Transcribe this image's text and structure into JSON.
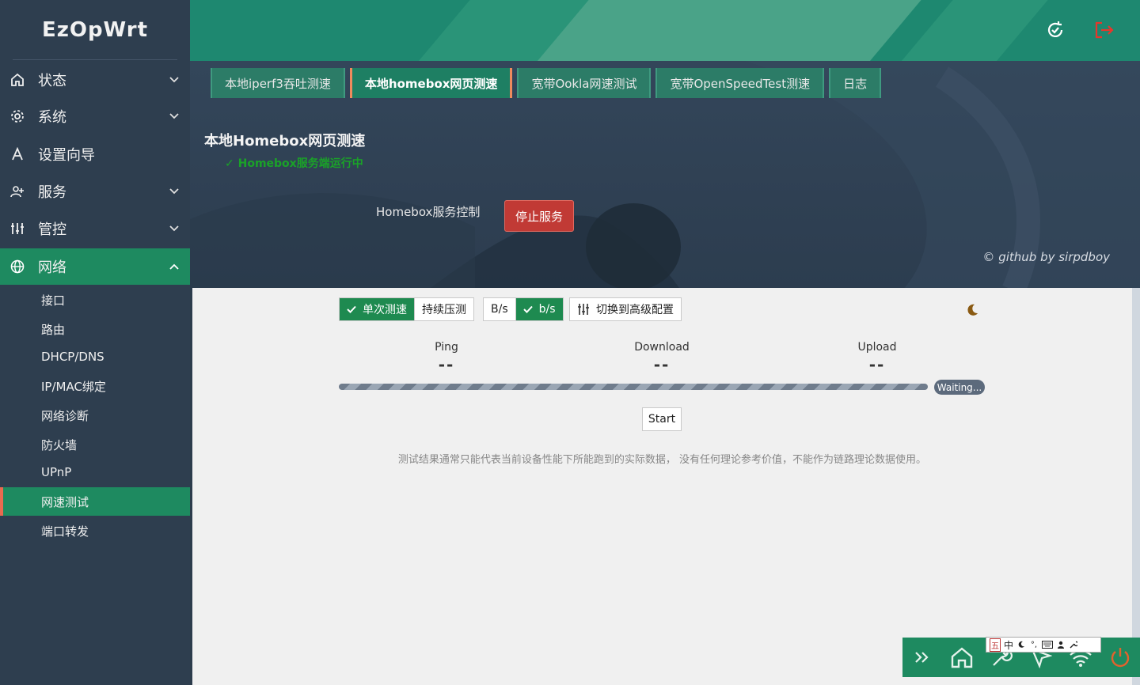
{
  "brand": "EzOpWrt",
  "menu": [
    {
      "label": "状态",
      "icon": "home-icon",
      "has_arrow": true
    },
    {
      "label": "系统",
      "icon": "gear-icon",
      "has_arrow": true
    },
    {
      "label": "设置向导",
      "icon": "wizard-icon",
      "has_arrow": false
    },
    {
      "label": "服务",
      "icon": "user-plus-icon",
      "has_arrow": true
    },
    {
      "label": "管控",
      "icon": "sliders-icon",
      "has_arrow": true
    },
    {
      "label": "网络",
      "icon": "globe-icon",
      "has_arrow": true,
      "expanded": true
    }
  ],
  "submenu": [
    "接口",
    "路由",
    "DHCP/DNS",
    "IP/MAC绑定",
    "网络诊断",
    "防火墙",
    "UPnP",
    "网速测试",
    "端口转发"
  ],
  "submenu_active": "网速测试",
  "tabs": [
    "本地iperf3吞吐测速",
    "本地homebox网页测速",
    "宽带Ookla网速测试",
    "宽带OpenSpeedTest测速",
    "日志"
  ],
  "active_tab": "本地homebox网页测速",
  "section": {
    "title": "本地Homebox网页测速",
    "status": "✓ Homebox服务端运行中",
    "control_label": "Homebox服务控制",
    "stop_button": "停止服务",
    "credit": "© github by sirpdboy"
  },
  "speedtest": {
    "mode_single": "单次测速",
    "mode_continuous": "持续压测",
    "unit_bytes": "B/s",
    "unit_bits": "b/s",
    "advanced": "切换到高级配置",
    "metrics": [
      {
        "label": "Ping",
        "value": "--"
      },
      {
        "label": "Download",
        "value": "--"
      },
      {
        "label": "Upload",
        "value": "--"
      }
    ],
    "status_badge": "Waiting...",
    "start_button": "Start",
    "note": "测试结果通常只能代表当前设备性能下所能跑到的实际数据， 没有任何理论参考价值，不能作为链路理论数据使用。"
  },
  "ime": {
    "chars": [
      "五",
      "中"
    ]
  },
  "colors": {
    "accent": "#1e8a60",
    "header": "#1e8870",
    "danger": "#c13a35",
    "sidebar": "#2e3e4f"
  }
}
